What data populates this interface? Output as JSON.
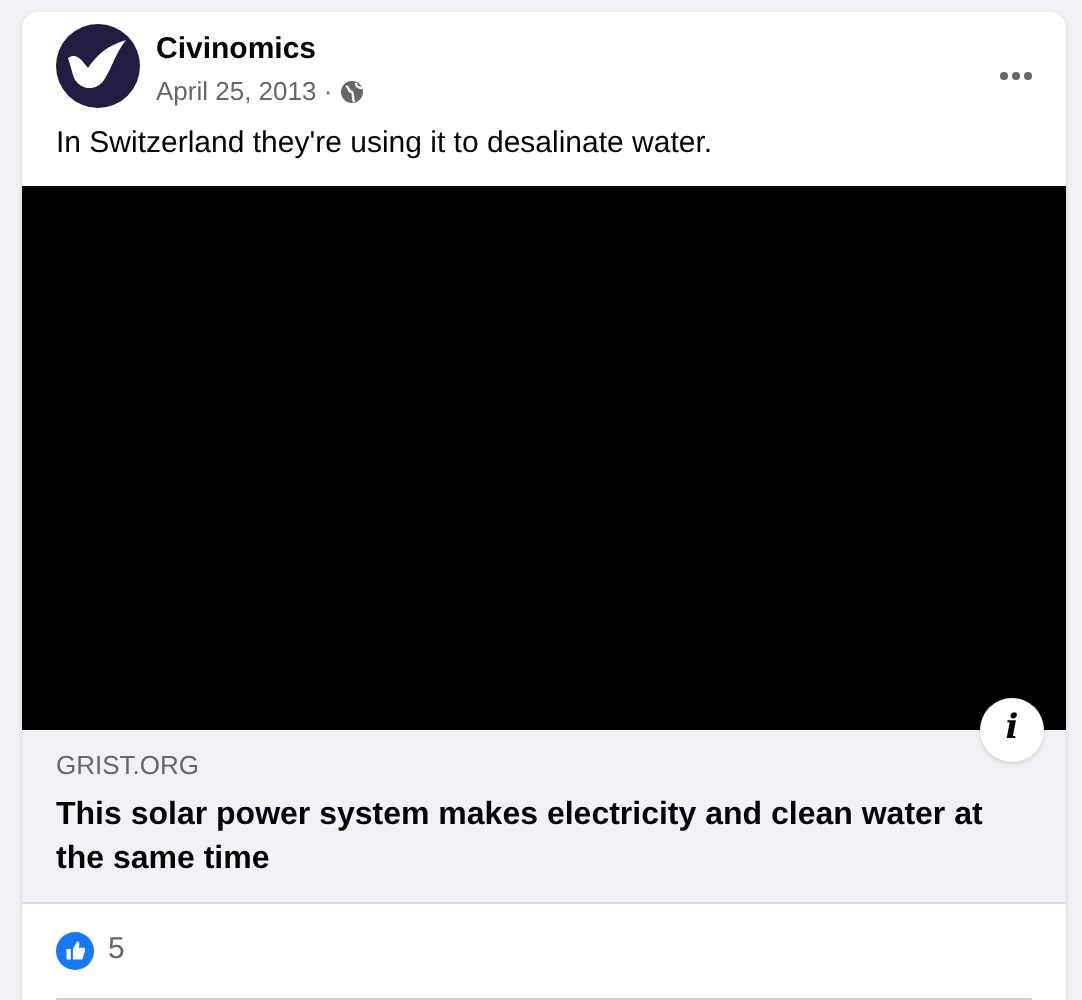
{
  "post": {
    "author": "Civinomics",
    "date": "April 25, 2013 ·",
    "text": "In Switzerland they're using it to desalinate water."
  },
  "link_preview": {
    "domain": "GRIST.ORG",
    "title": "This solar power system makes electricity and clean water at the same time",
    "info_button": "i"
  },
  "reactions": {
    "count": "5"
  }
}
